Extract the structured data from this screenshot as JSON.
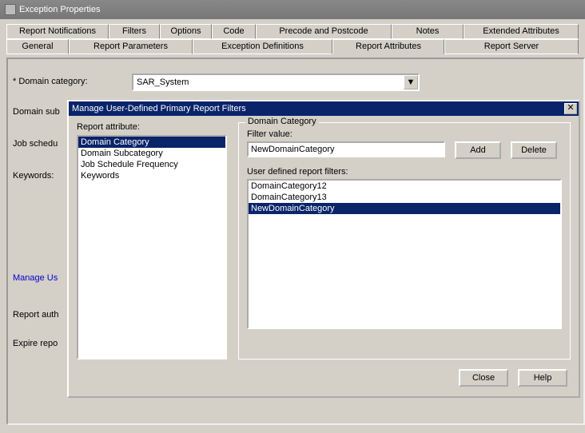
{
  "window": {
    "title": "Exception Properties"
  },
  "tabs_row1": [
    "Report Notifications",
    "Filters",
    "Options",
    "Code",
    "Precode and Postcode",
    "Notes",
    "Extended Attributes"
  ],
  "tabs_row2": [
    "General",
    "Report Parameters",
    "Exception Definitions",
    "Report Attributes",
    "Report Server"
  ],
  "selected_tab": "Report Attributes",
  "main": {
    "domain_category_label": "* Domain category:",
    "domain_category_value": "SAR_System",
    "domain_sub_label": "Domain sub",
    "job_sched_label": "Job schedu",
    "keywords_label": "Keywords:",
    "manage_link": "Manage Us",
    "report_auth_label": "Report auth",
    "expire_repo_label": "Expire repo"
  },
  "dialog": {
    "title": "Manage User-Defined Primary Report Filters",
    "report_attr_label": "Report attribute:",
    "report_attrs": [
      "Domain Category",
      "Domain Subcategory",
      "Job Schedule Frequency",
      "Keywords"
    ],
    "report_attr_selected": 0,
    "fieldset_legend": "Domain Category",
    "filter_value_label": "Filter value:",
    "filter_value": "NewDomainCategory",
    "add_label": "Add",
    "delete_label": "Delete",
    "userdef_label": "User defined report filters:",
    "userdef_items": [
      "DomainCategory12",
      "DomainCategory13",
      "NewDomainCategory"
    ],
    "userdef_selected": 2,
    "close_label": "Close",
    "help_label": "Help"
  }
}
